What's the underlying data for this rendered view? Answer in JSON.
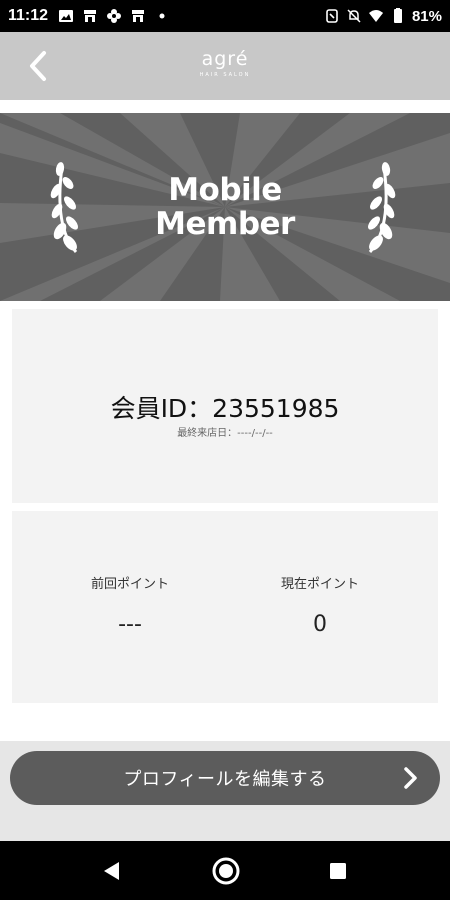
{
  "status_bar": {
    "time": "11:12",
    "battery_percent": "81%",
    "left_icons": [
      "image-icon",
      "store-icon",
      "flower-icon",
      "store-icon",
      "dot-icon"
    ],
    "right_icons": [
      "nfc-icon",
      "mute-icon",
      "wifi-icon",
      "battery-icon"
    ]
  },
  "header": {
    "back_icon": "chevron-left-icon",
    "logo_name": "agré",
    "logo_tagline": "HAIR SALON"
  },
  "banner": {
    "title_line1": "Mobile",
    "title_line2": "Member",
    "decoration": "laurel-icon"
  },
  "member_card": {
    "member_id": "会員ID：23551985",
    "last_visit": "最終来店日：----/--/--"
  },
  "points_card": {
    "previous_label": "前回ポイント",
    "previous_value": "---",
    "current_label": "現在ポイント",
    "current_value": "0"
  },
  "edit_button": {
    "label": "プロフィールを編集する",
    "icon": "chevron-right-icon"
  },
  "nav_bar": {
    "back_icon": "triangle-back-icon",
    "home_icon": "circle-home-icon",
    "recents_icon": "square-recents-icon"
  },
  "colors": {
    "header_bg": "#c8c8c8",
    "banner_bg": "#606060",
    "card_bg": "#f3f3f3",
    "button_bg": "#5c5c5c"
  }
}
